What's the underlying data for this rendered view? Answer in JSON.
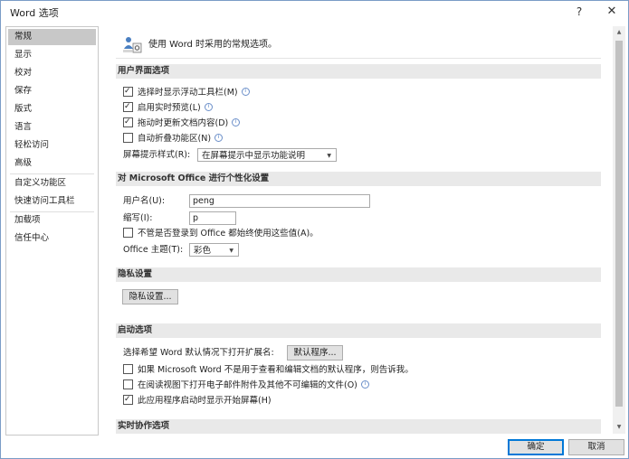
{
  "window": {
    "title": "Word 选项",
    "help": "?",
    "close": "✕"
  },
  "sidebar": {
    "items": [
      {
        "label": "常规"
      },
      {
        "label": "显示"
      },
      {
        "label": "校对"
      },
      {
        "label": "保存"
      },
      {
        "label": "版式"
      },
      {
        "label": "语言"
      },
      {
        "label": "轻松访问"
      },
      {
        "label": "高级"
      },
      {
        "label": "自定义功能区"
      },
      {
        "label": "快速访问工具栏"
      },
      {
        "label": "加载项"
      },
      {
        "label": "信任中心"
      }
    ],
    "selected": "常规"
  },
  "header": {
    "text": "使用 Word 时采用的常规选项。",
    "icon": "general-options-icon"
  },
  "ui_section": {
    "title": "用户界面选项",
    "options": [
      {
        "label": "选择时显示浮动工具栏(M)",
        "checked": true,
        "info": true
      },
      {
        "label": "启用实时预览(L)",
        "checked": true,
        "info": true
      },
      {
        "label": "拖动时更新文档内容(D)",
        "checked": true,
        "info": true
      },
      {
        "label": "自动折叠功能区(N)",
        "checked": false,
        "info": true
      }
    ],
    "screentip_label": "屏幕提示样式(R):",
    "screentip_value": "在屏幕提示中显示功能说明"
  },
  "personalize_section": {
    "title": "对 Microsoft Office 进行个性化设置",
    "username_label": "用户名(U):",
    "username_value": "peng",
    "initials_label": "缩写(I):",
    "initials_value": "p",
    "always_use_label": "不管是否登录到 Office 都始终使用这些值(A)。",
    "always_use_checked": false,
    "theme_label": "Office 主题(T):",
    "theme_value": "彩色"
  },
  "privacy_section": {
    "title": "隐私设置",
    "button": "隐私设置..."
  },
  "startup_section": {
    "title": "启动选项",
    "extensions_label": "选择希望 Word 默认情况下打开扩展名:",
    "default_programs_button": "默认程序...",
    "options": [
      {
        "label": "如果 Microsoft Word 不是用于查看和编辑文档的默认程序，则告诉我。",
        "checked": false
      },
      {
        "label": "在阅读视图下打开电子邮件附件及其他不可编辑的文件(O)",
        "checked": false,
        "info": true
      },
      {
        "label": "此应用程序启动时显示开始屏幕(H)",
        "checked": true
      }
    ]
  },
  "realtime_section": {
    "title": "实时协作选项"
  },
  "footer": {
    "ok": "确定",
    "cancel": "取消"
  },
  "icons": {
    "info": "i",
    "caret": "▼",
    "scroll_up": "▲",
    "scroll_down": "▼"
  }
}
